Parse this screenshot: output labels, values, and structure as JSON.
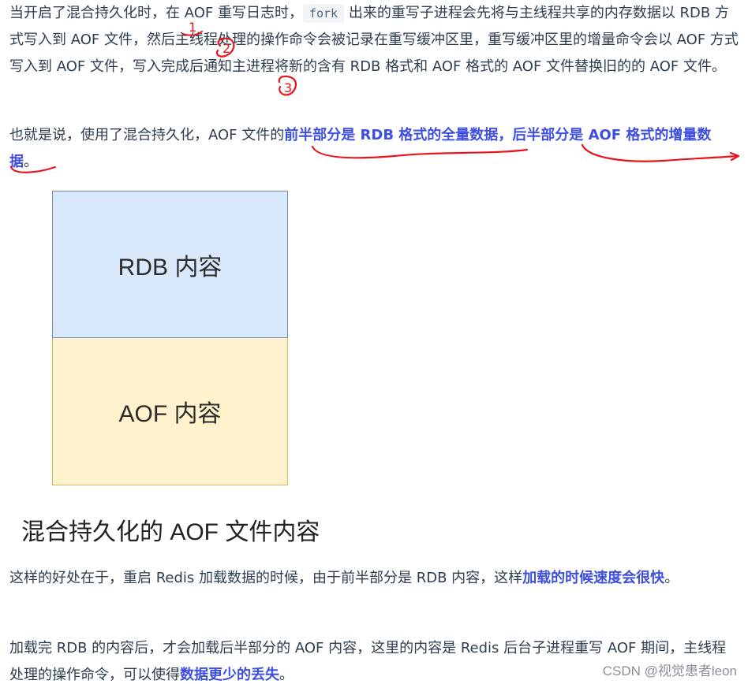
{
  "paragraph1": {
    "part1": "当开启了混合持久化时，在 AOF 重写日志时，",
    "code": "fork",
    "part2": " 出来的重写子进程会先将与主线程共享的内存数据以 RDB 方式写入到 AOF 文件，然后主线程处理的操作命令会被记录在重写缓冲区里，重写缓冲区里的增量命令会以 AOF 方式写入到 AOF 文件，写入完成后通知主进程将新的含有 RDB 格式和 AOF 格式的 AOF 文件替换旧的的 AOF 文件。"
  },
  "paragraph2": {
    "part1": "也就是说，使用了混合持久化，AOF 文件的",
    "strong": "前半部分是 RDB 格式的全量数据，后半部分是 AOF 格式的增量数据",
    "part2": "。"
  },
  "diagram": {
    "top_label": "RDB 内容",
    "bottom_label": "AOF 内容",
    "caption": "混合持久化的 AOF 文件内容"
  },
  "paragraph3": {
    "part1": "这样的好处在于，重启 Redis 加载数据的时候，由于前半部分是 RDB 内容，这样",
    "strong": "加载的时候速度会很快",
    "part2": "。"
  },
  "paragraph4": {
    "part1": "加载完 RDB 的内容后，才会加载后半部分的 AOF 内容，这里的内容是 Redis 后台子进程重写 AOF 期间，主线程处理的操作命令，可以使得",
    "strong": "数据更少的丢失",
    "part2": "。"
  },
  "annotations": {
    "mark1": "1",
    "mark2": "2",
    "mark3": "3",
    "ink_color": "#e8141b"
  },
  "watermark": "CSDN @视觉患者leon"
}
